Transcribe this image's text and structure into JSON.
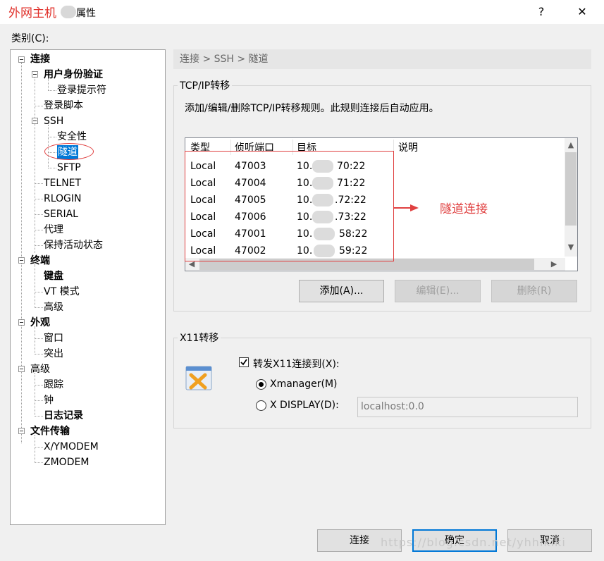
{
  "titlebar": {
    "watermark": "外网主机",
    "title": "属性",
    "help": "?",
    "close": "✕"
  },
  "category_label": "类别(C):",
  "tree": [
    {
      "label": "连接",
      "bold": true
    },
    {
      "label": "用户身份验证",
      "bold": true
    },
    {
      "label": "登录提示符"
    },
    {
      "label": "登录脚本"
    },
    {
      "label": "SSH"
    },
    {
      "label": "安全性"
    },
    {
      "label": "隧道",
      "selected": true
    },
    {
      "label": "SFTP"
    },
    {
      "label": "TELNET"
    },
    {
      "label": "RLOGIN"
    },
    {
      "label": "SERIAL"
    },
    {
      "label": "代理"
    },
    {
      "label": "保持活动状态"
    },
    {
      "label": "终端",
      "bold": true
    },
    {
      "label": "键盘",
      "bold": true
    },
    {
      "label": "VT 模式"
    },
    {
      "label": "高级"
    },
    {
      "label": "外观",
      "bold": true
    },
    {
      "label": "窗口"
    },
    {
      "label": "突出"
    },
    {
      "label": "高级"
    },
    {
      "label": "跟踪"
    },
    {
      "label": "钟"
    },
    {
      "label": "日志记录",
      "bold": true
    },
    {
      "label": "文件传输",
      "bold": true
    },
    {
      "label": "X/YMODEM"
    },
    {
      "label": "ZMODEM"
    }
  ],
  "breadcrumb": "连接 > SSH > 隧道",
  "tcp": {
    "title": "TCP/IP转移",
    "description": "添加/编辑/删除TCP/IP转移规则。此规则连接后自动应用。",
    "headers": [
      "类型",
      "侦听端口",
      "目标",
      "说明"
    ],
    "rows": [
      {
        "type": "Local",
        "port": "47003",
        "target_a": "10.",
        "target_b": "70:22"
      },
      {
        "type": "Local",
        "port": "47004",
        "target_a": "10.",
        "target_b": "71:22"
      },
      {
        "type": "Local",
        "port": "47005",
        "target_a": "10.",
        "target_b": ".72:22"
      },
      {
        "type": "Local",
        "port": "47006",
        "target_a": "10.",
        "target_b": ".73:22"
      },
      {
        "type": "Local",
        "port": "47001",
        "target_a": "10.",
        "target_b": "58:22"
      },
      {
        "type": "Local",
        "port": "47002",
        "target_a": "10.",
        "target_b": "59:22"
      }
    ],
    "add": "添加(A)...",
    "edit": "编辑(E)...",
    "delete": "删除(R)"
  },
  "annotation": "隧道连接",
  "x11": {
    "title": "X11转移",
    "forward_label": "转发X11连接到(X):",
    "forward_checked": true,
    "xmanager": "Xmanager(M)",
    "xdisplay": "X DISPLAY(D):",
    "display_value": "localhost:0.0"
  },
  "footer": {
    "connect": "连接",
    "ok": "确定",
    "cancel": "取消"
  },
  "watermark": "https://blog.csdn.net/yhhikiki"
}
